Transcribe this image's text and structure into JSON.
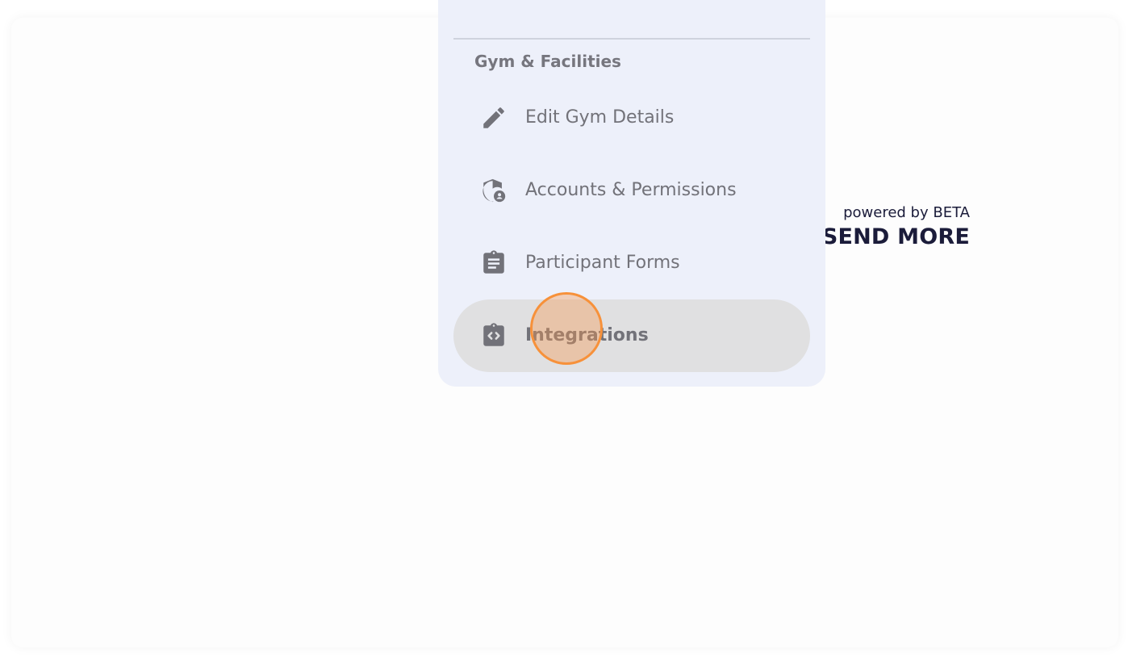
{
  "brand": {
    "subtitle": "powered by BETA",
    "title": "SEND MORE"
  },
  "menu": {
    "section_title": "Gym & Facilities",
    "items": [
      {
        "label": "Edit Gym Details",
        "icon": "pencil-icon",
        "active": false
      },
      {
        "label": "Accounts & Permissions",
        "icon": "shield-account-icon",
        "active": false
      },
      {
        "label": "Participant Forms",
        "icon": "clipboard-text-icon",
        "active": false
      },
      {
        "label": "Integrations",
        "icon": "clipboard-code-icon",
        "active": true
      }
    ]
  },
  "colors": {
    "menu_background": "#edf0fa",
    "active_item_background": "#e0e0e1",
    "text_gray": "#727279",
    "brand_dark": "#1b1c3a",
    "click_marker": "#f7913a"
  }
}
